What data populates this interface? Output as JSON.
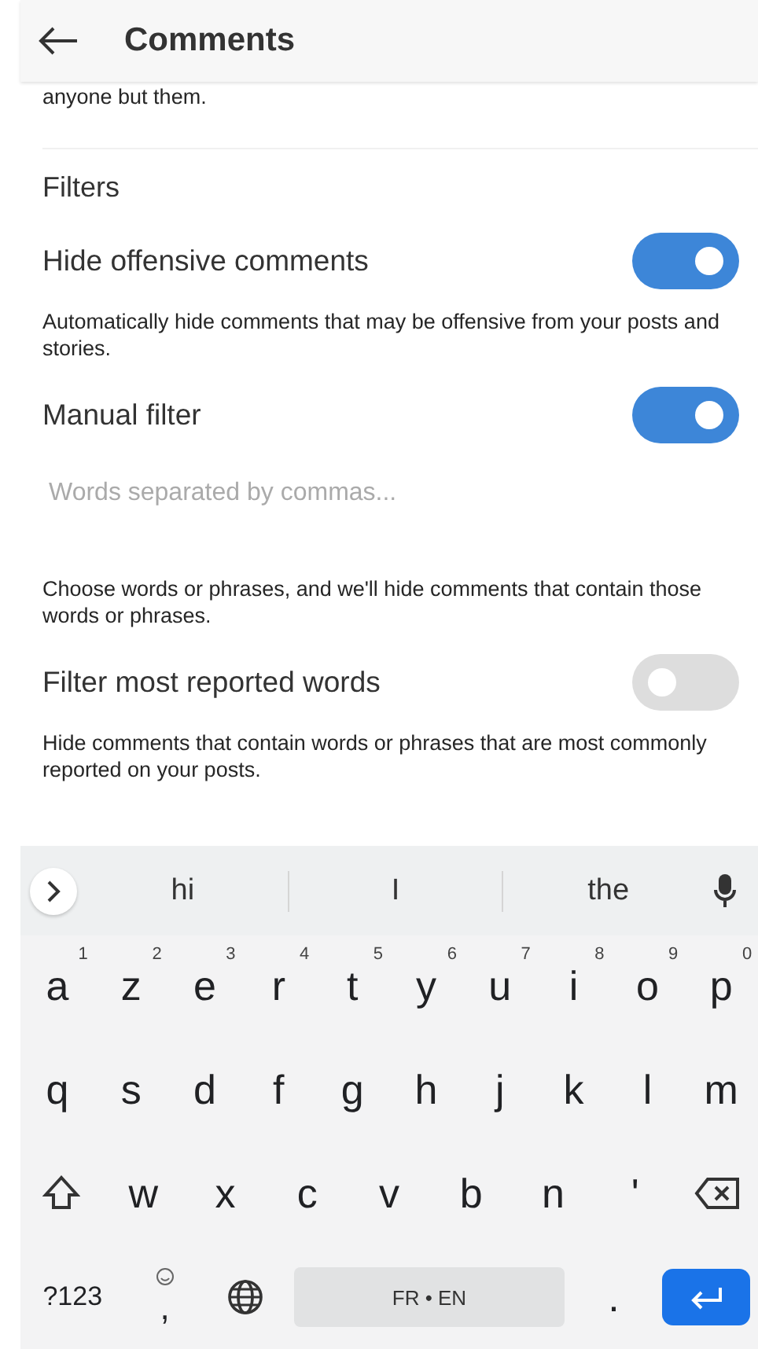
{
  "header": {
    "title": "Comments"
  },
  "intro_text": "anyone but them.",
  "section_title": "Filters",
  "settings": [
    {
      "kind": "toggle",
      "label": "Hide offensive comments",
      "on": true,
      "description": "Automatically hide comments that may be offensive from your posts and stories."
    },
    {
      "kind": "toggle",
      "label": "Manual filter",
      "on": true
    },
    {
      "kind": "field",
      "placeholder": "Words separated by commas...",
      "description": "Choose words or phrases, and we'll hide comments that contain those words or phrases."
    },
    {
      "kind": "toggle",
      "label": "Filter most reported words",
      "on": false,
      "description": "Hide comments that contain words or phrases that are most commonly reported on your posts."
    }
  ],
  "keyboard": {
    "suggestions": [
      "hi",
      "I",
      "the"
    ],
    "letter_rows": [
      {
        "kind": "plain",
        "keys": [
          {
            "key": "a",
            "hint": "1"
          },
          {
            "key": "z",
            "hint": "2"
          },
          {
            "key": "e",
            "hint": "3"
          },
          {
            "key": "r",
            "hint": "4"
          },
          {
            "key": "t",
            "hint": "5"
          },
          {
            "key": "y",
            "hint": "6"
          },
          {
            "key": "u",
            "hint": "7"
          },
          {
            "key": "i",
            "hint": "8"
          },
          {
            "key": "o",
            "hint": "9"
          },
          {
            "key": "p",
            "hint": "0"
          }
        ]
      },
      {
        "kind": "plain",
        "keys": [
          {
            "key": "q"
          },
          {
            "key": "s"
          },
          {
            "key": "d"
          },
          {
            "key": "f"
          },
          {
            "key": "g"
          },
          {
            "key": "h"
          },
          {
            "key": "j"
          },
          {
            "key": "k"
          },
          {
            "key": "l"
          },
          {
            "key": "m"
          }
        ]
      },
      {
        "kind": "shift_backspace",
        "keys": [
          {
            "key": "w"
          },
          {
            "key": "x"
          },
          {
            "key": "c"
          },
          {
            "key": "v"
          },
          {
            "key": "b"
          },
          {
            "key": "n"
          },
          {
            "key": "'"
          }
        ]
      }
    ],
    "bottom_row": {
      "symbols_key": "?123",
      "comma_key": ",",
      "space_label": "FR • EN",
      "period_key": "."
    }
  }
}
